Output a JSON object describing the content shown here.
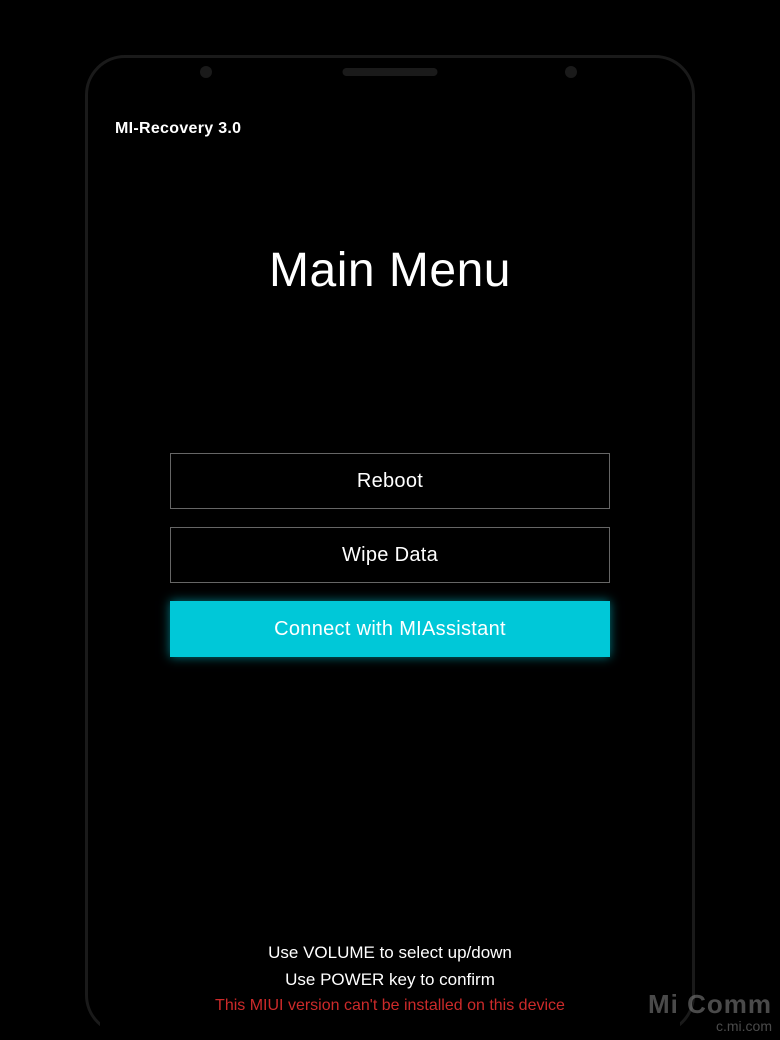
{
  "header": {
    "version": "MI-Recovery 3.0"
  },
  "title": "Main Menu",
  "menu": {
    "items": [
      {
        "label": "Reboot",
        "selected": false
      },
      {
        "label": "Wipe Data",
        "selected": false
      },
      {
        "label": "Connect with MIAssistant",
        "selected": true
      }
    ]
  },
  "footer": {
    "line1": "Use VOLUME to select up/down",
    "line2": "Use POWER key to confirm",
    "error": "This MIUI version can't be installed on this device"
  },
  "watermark": {
    "top": "Mi Comm",
    "bottom": "c.mi.com"
  }
}
